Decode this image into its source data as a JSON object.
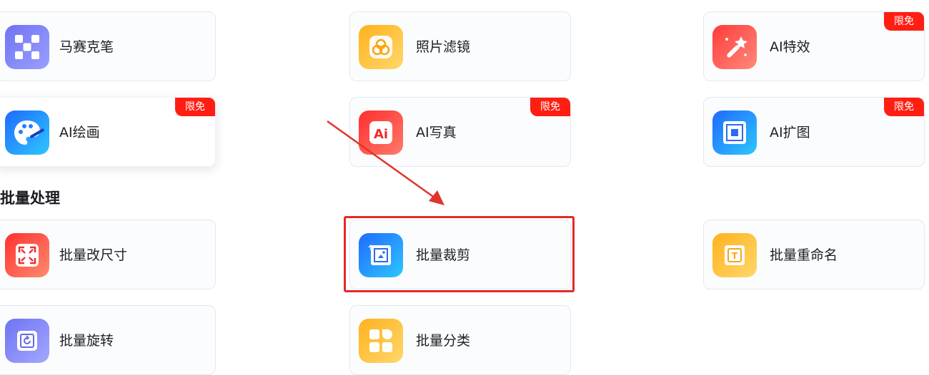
{
  "row1": [
    {
      "label": "马赛克笔",
      "icon": "mosaic-icon"
    },
    {
      "label": "照片滤镜",
      "icon": "photo-filter-icon"
    },
    {
      "label": "AI特效",
      "icon": "magic-wand-icon",
      "badge": "限免"
    }
  ],
  "row2": [
    {
      "label": "AI绘画",
      "icon": "palette-icon",
      "badge": "限免"
    },
    {
      "label": "AI写真",
      "icon": "ai-portrait-icon",
      "badge": "限免"
    },
    {
      "label": "AI扩图",
      "icon": "expand-image-icon",
      "badge": "限免"
    }
  ],
  "batch": {
    "title": "批量处理",
    "row1": [
      {
        "label": "批量改尺寸",
        "icon": "resize-icon"
      },
      {
        "label": "批量裁剪",
        "icon": "crop-icon"
      },
      {
        "label": "批量重命名",
        "icon": "rename-icon"
      }
    ],
    "row2": [
      {
        "label": "批量旋转",
        "icon": "rotate-icon"
      },
      {
        "label": "批量分类",
        "icon": "classify-icon"
      }
    ]
  },
  "colors": {
    "badge": "#ff1e12",
    "highlight": "#e32a2a",
    "annotation_arrow": "#e0352c"
  }
}
